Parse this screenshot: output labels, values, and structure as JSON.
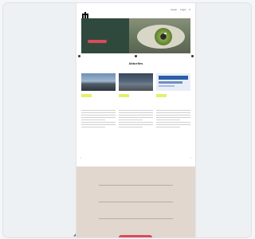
{
  "page": {
    "brand": "e",
    "nav": [
      "Lesen",
      "Login"
    ]
  },
  "hero": {
    "eyebrow": "",
    "title": "",
    "button": ""
  },
  "news": {
    "title": "Aktuelles",
    "cards": [
      {
        "tag": "",
        "title": "",
        "meta": ""
      },
      {
        "tag": "",
        "title": "",
        "meta": ""
      },
      {
        "tag": "",
        "title": "",
        "meta": ""
      }
    ],
    "pager": ""
  },
  "events": {
    "title": "",
    "items": [
      {
        "date": "",
        "title": "",
        "place": ""
      },
      {
        "date": "",
        "title": "",
        "place": ""
      },
      {
        "date": "",
        "title": "",
        "place": ""
      }
    ],
    "button": ""
  },
  "colors": {
    "accent": "#d84b5c",
    "hero_bg": "#2f4a3d",
    "tag": "#e4f06a",
    "events_bg": "#e1d7ce"
  }
}
